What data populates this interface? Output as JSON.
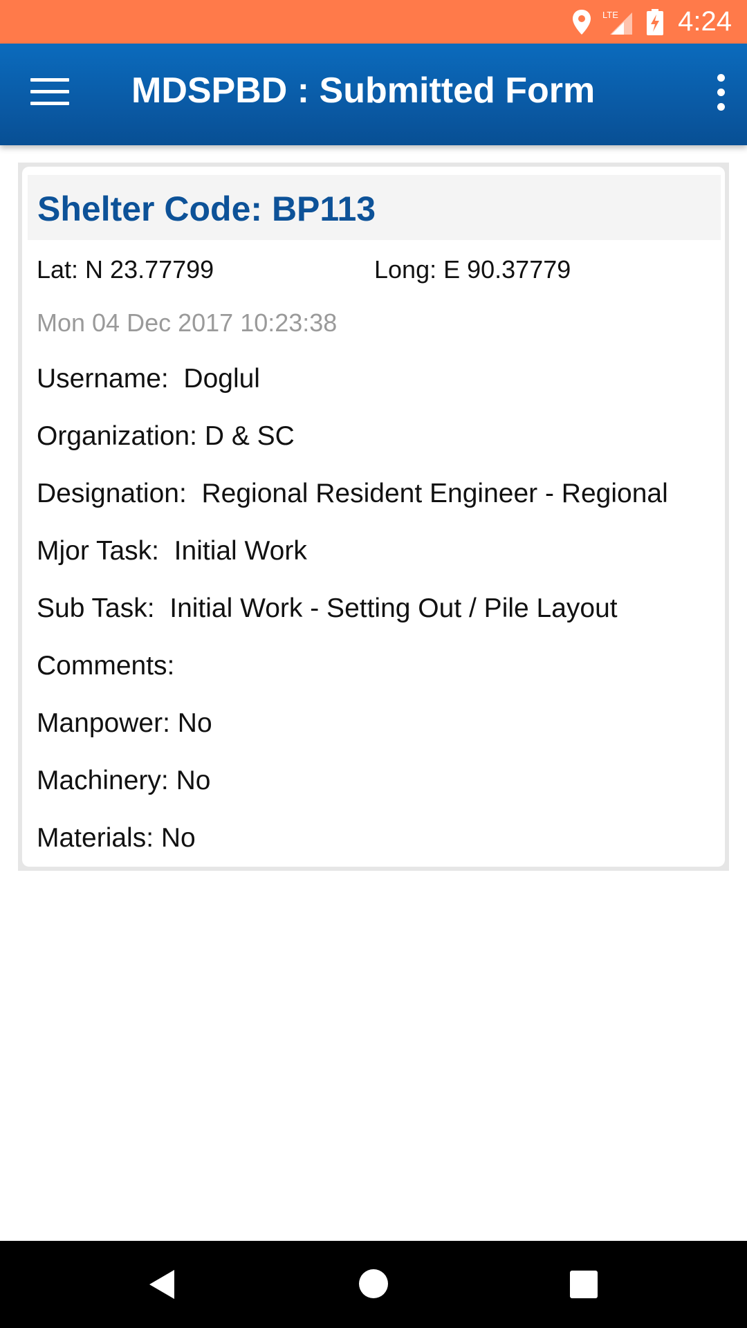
{
  "status_bar": {
    "time": "4:24",
    "network": "LTE",
    "colors": {
      "background": "#ff7a4a"
    }
  },
  "app_bar": {
    "title": "MDSPBD : Submitted Form",
    "menu_icon": "menu-icon",
    "overflow_icon": "more-vert-icon",
    "colors": {
      "background": "#0a5aa5"
    }
  },
  "form": {
    "shelter_code": "Shelter Code: BP113",
    "lat": "Lat: N 23.77799",
    "long": "Long: E 90.37779",
    "timestamp": "Mon 04 Dec 2017 10:23:38",
    "fields": [
      {
        "label": "Username:",
        "value": "Doglul"
      },
      {
        "label": "Organization:",
        "value": "D & SC"
      },
      {
        "label": "Designation:",
        "value": "Regional Resident Engineer - Regional"
      },
      {
        "label": "Mjor Task:",
        "value": "Initial Work"
      },
      {
        "label": "Sub Task:",
        "value": "Initial Work - Setting Out / Pile Layout"
      },
      {
        "label": "Comments:",
        "value": ""
      },
      {
        "label": "Manpower:",
        "value": "No"
      },
      {
        "label": "Machinery:",
        "value": "No"
      },
      {
        "label": "Materials:",
        "value": "No"
      }
    ],
    "colors": {
      "title": "#0d5298",
      "timestamp": "#9a9a9a"
    }
  },
  "nav_bar": {
    "back_icon": "back-triangle-icon",
    "home_icon": "home-circle-icon",
    "recents_icon": "recents-square-icon"
  }
}
